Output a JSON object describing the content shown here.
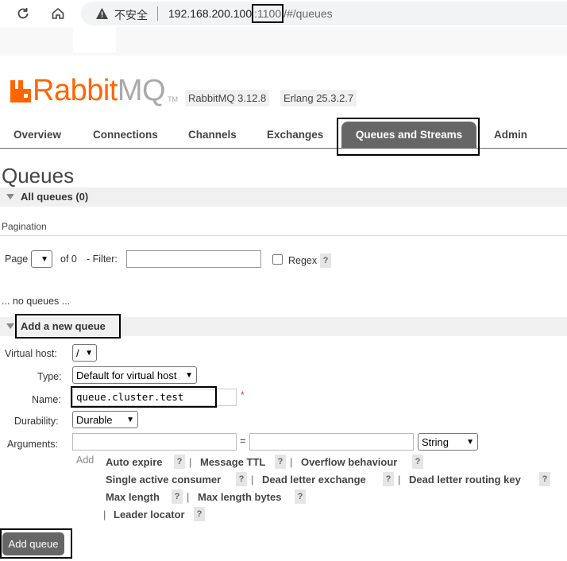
{
  "browser": {
    "insecure_label": "不安全",
    "url_host": "192.168.200.100",
    "url_port": ":1100",
    "url_path": "/#/queues"
  },
  "header": {
    "logo_rabbit": "Rabbit",
    "logo_mq": "MQ",
    "logo_tm": "TM",
    "rabbit_version": "RabbitMQ 3.12.8",
    "erlang_version": "Erlang 25.3.2.7"
  },
  "tabs": [
    "Overview",
    "Connections",
    "Channels",
    "Exchanges",
    "Queues and Streams",
    "Admin"
  ],
  "page_title": "Queues",
  "all_queues": "All queues (0)",
  "pagination": {
    "title": "Pagination",
    "page_label": "Page",
    "of_label": "of 0",
    "filter_label": "- Filter:",
    "regex_label": "Regex",
    "help": "?"
  },
  "no_queues": "... no queues ...",
  "add_section": "Add a new queue",
  "form": {
    "vhost_label": "Virtual host:",
    "vhost_value": "/",
    "type_label": "Type:",
    "type_value": "Default for virtual host",
    "name_label": "Name:",
    "name_value": "queue.cluster.test",
    "required_mark": "*",
    "durability_label": "Durability:",
    "durability_value": "Durable",
    "arguments_label": "Arguments:",
    "equals": "=",
    "arg_type": "String",
    "add_label": "Add"
  },
  "args": {
    "auto_expire": "Auto expire",
    "message_ttl": "Message TTL",
    "overflow": "Overflow behaviour",
    "single_active": "Single active consumer",
    "dead_letter_exchange": "Dead letter exchange",
    "dead_letter_routing": "Dead letter routing key",
    "max_length": "Max length",
    "max_length_bytes": "Max length bytes",
    "leader_locator": "Leader locator",
    "pipe": "|",
    "help": "?"
  },
  "add_queue_button": "Add queue"
}
